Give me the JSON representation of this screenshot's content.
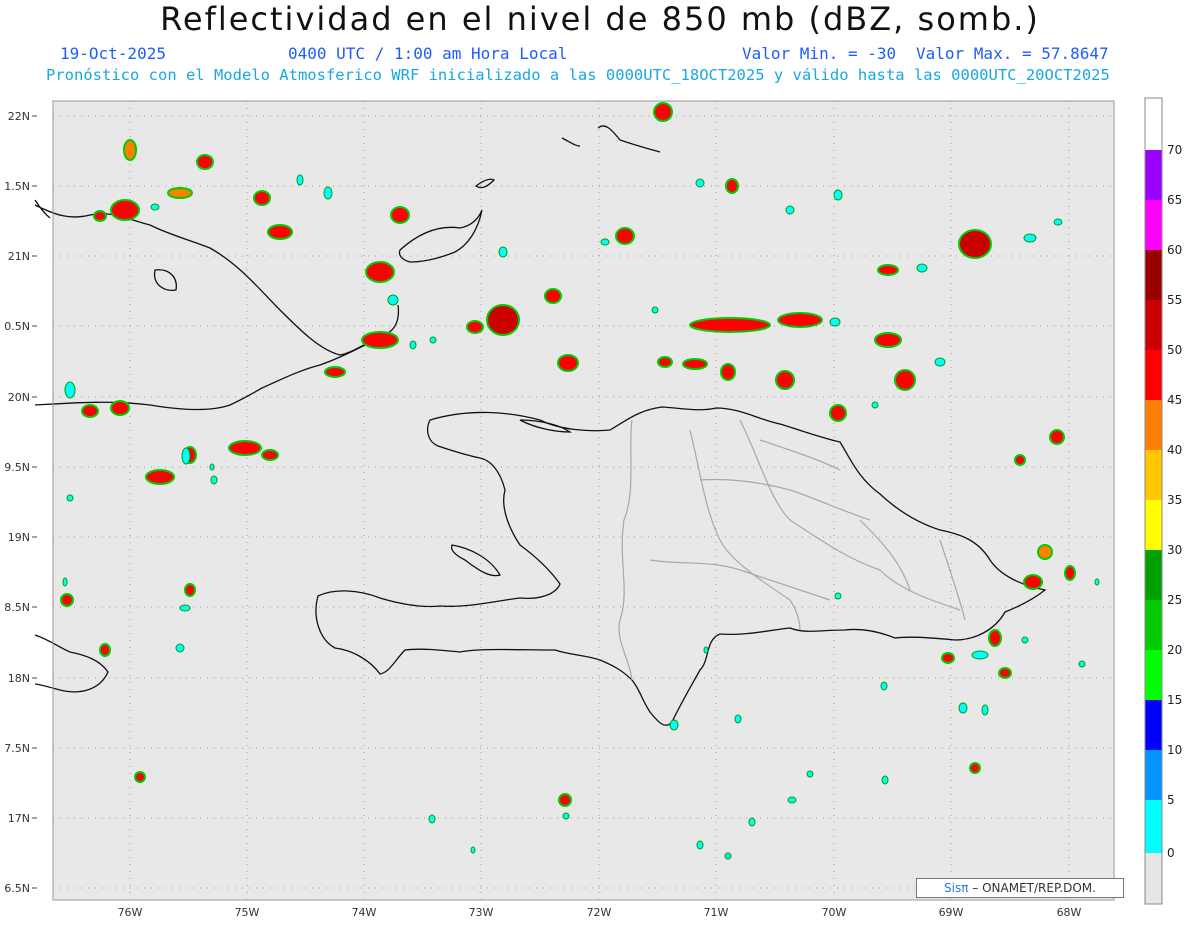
{
  "header": {
    "title": "Reflectividad en el nivel de 850 mb (dBZ, somb.)",
    "date": "19-Oct-2025",
    "time": "0400 UTC / 1:00 am Hora Local",
    "min_label": "Valor Min. = -30",
    "max_label": "Valor Max. = 57.8647",
    "forecast_info": "Pronóstico con el Modelo Atmosferico WRF inicializado a las 0000UTC_18OCT2025 y válido hasta las  0000UTC_20OCT2025"
  },
  "axes": {
    "lat_labels": [
      "22N",
      "1.5N",
      "21N",
      "0.5N",
      "20N",
      "9.5N",
      "19N",
      "8.5N",
      "18N",
      "7.5N",
      "17N",
      "6.5N"
    ],
    "lon_labels": [
      "76W",
      "75W",
      "74W",
      "73W",
      "72W",
      "71W",
      "70W",
      "69W",
      "68W"
    ]
  },
  "colorbar": {
    "ticks": [
      "70",
      "65",
      "60",
      "55",
      "50",
      "45",
      "40",
      "35",
      "30",
      "25",
      "20",
      "15",
      "10",
      "5",
      "0"
    ],
    "colors": [
      "#ffffff",
      "#9900ff",
      "#ff00ff",
      "#990000",
      "#cc0000",
      "#ff0000",
      "#ff8000",
      "#ffc800",
      "#ffff00",
      "#00a000",
      "#00cc00",
      "#00ff00",
      "#0000ff",
      "#0096ff",
      "#00ffff",
      "#e6e6e6"
    ]
  },
  "credit": {
    "sis": "Sisπ",
    "org": "– ONAMET/REP.DOM."
  }
}
